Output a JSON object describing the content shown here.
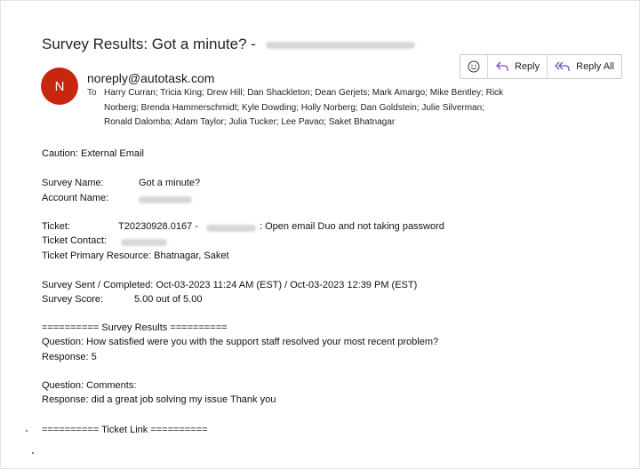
{
  "email": {
    "subject": "Survey Results: Got a minute? -",
    "avatar_initial": "N",
    "from": "noreply@autotask.com",
    "to_label": "To",
    "to_recipients": "Harry Curran; Tricia King; Drew Hill; Dan Shackleton; Dean Gerjets; Mark Amargo; Mike Bentley; Rick Norberg; Brenda Hammerschmidt; Kyle Dowding; Holly Norberg; Dan Goldstein; Julie Silverman; Ronald Dalomba; Adam Taylor; Julia Tucker; Lee Pavao; Saket Bhatnagar"
  },
  "actions": {
    "reply_label": "Reply",
    "reply_all_label": "Reply All"
  },
  "body": {
    "caution": "Caution: External Email",
    "survey_name_label": "Survey Name:",
    "survey_name_value": "Got a minute?",
    "account_name_label": "Account Name:",
    "ticket_label": "Ticket:",
    "ticket_number": "T20230928.0167 -",
    "ticket_title": ": Open email Duo and not taking password",
    "ticket_contact_label": "Ticket Contact:",
    "ticket_primary_resource": "Ticket Primary Resource: Bhatnagar, Saket",
    "survey_sent_completed": "Survey Sent / Completed: Oct-03-2023 11:24 AM (EST) / Oct-03-2023 12:39 PM (EST)",
    "survey_score_label": "Survey Score:",
    "survey_score_value": "5.00 out of 5.00",
    "survey_results_header": "========== Survey Results ==========",
    "question1": "Question: How satisfied were you with the support staff resolved your most recent problem?",
    "response1": "Response: 5",
    "question2": "Question: Comments:",
    "response2": "Response: did a great job solving my issue Thank you",
    "ticket_link_header": "========== Ticket Link =========="
  }
}
